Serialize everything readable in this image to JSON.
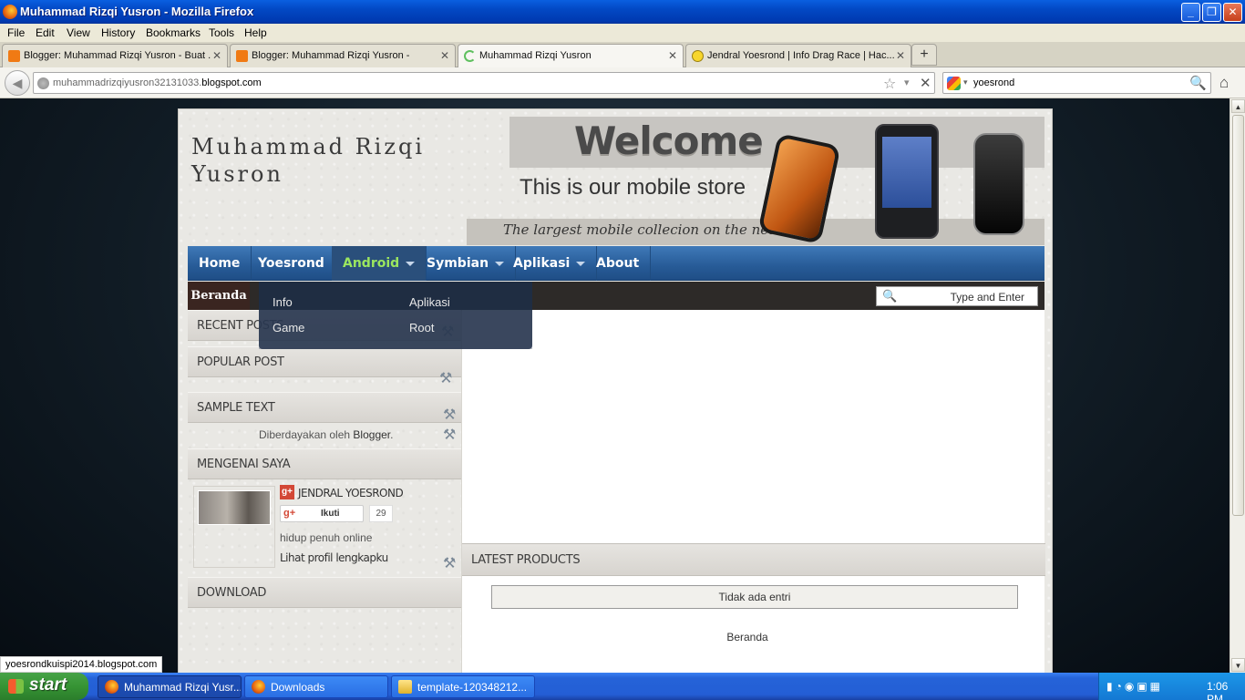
{
  "window": {
    "title": "Muhammad Rizqi Yusron - Mozilla Firefox",
    "controls": {
      "minimize": "_",
      "maximize": "❐",
      "close": "✕"
    }
  },
  "menu": [
    "File",
    "Edit",
    "View",
    "History",
    "Bookmarks",
    "Tools",
    "Help"
  ],
  "tabs": [
    {
      "label": "Blogger: Muhammad Rizqi Yusron - Buat ...",
      "close": "✕"
    },
    {
      "label": "Blogger: Muhammad Rizqi Yusron -",
      "close": "✕"
    },
    {
      "label": "Muhammad Rizqi Yusron",
      "close": "✕"
    },
    {
      "label": "Jendral Yoesrond | Info Drag Race | Hac...",
      "close": "✕"
    }
  ],
  "new_tab": "+",
  "nav": {
    "back": "◀",
    "url_prefix": "muhammadrizqiyusron32131033.",
    "url_domain": "blogspot.com",
    "star": "☆",
    "dropdown": "▾",
    "stop": "✕",
    "search_engine_dropdown": "▾",
    "search_value": "yoesrond",
    "search_glyph": "🔍",
    "home": "⌂"
  },
  "scrollbar": {
    "up": "▲",
    "down": "▼"
  },
  "site": {
    "title": "Muhammad Rizqi Yusron",
    "banner": {
      "welcome": "Welcome",
      "store": "This is our mobile store",
      "tagline": "The largest mobile collecion on the net"
    },
    "nav_items": [
      {
        "label": "Home"
      },
      {
        "label": "Yoesrond"
      },
      {
        "label": "Android"
      },
      {
        "label": "Symbian"
      },
      {
        "label": "Aplikasi"
      },
      {
        "label": "About"
      }
    ],
    "breadcrumb": "Beranda",
    "search": {
      "icon": "🔍",
      "placeholder": "Type and Enter"
    },
    "dropdown": [
      "Info",
      "Aplikasi",
      "Game",
      "Root"
    ],
    "widgets": {
      "recent_posts": "RECENT POSTS",
      "popular_post": "POPULAR POST",
      "sample_text": "SAMPLE TEXT",
      "powered_prefix": "Diberdayakan oleh",
      "powered_brand": "Blogger",
      "powered_suffix": ".",
      "about_me": "MENGENAI SAYA",
      "download": "DOWNLOAD",
      "tool_glyph": "⚒"
    },
    "profile": {
      "badge": "g+",
      "name": "JENDRAL YOESROND",
      "follow_icon": "g+",
      "follow_label": "Ikuti",
      "follow_count": "29",
      "description": "hidup penuh online",
      "link": "Lihat profil lengkapku"
    },
    "content": {
      "latest_products": "LATEST PRODUCTS",
      "no_entries": "Tidak ada entri",
      "home_link": "Beranda"
    }
  },
  "status_link": "yoesrondkuispi2014.blogspot.com",
  "taskbar": {
    "start": "start",
    "items": [
      "Muhammad Rizqi Yusr...",
      "Downloads",
      "template-120348212..."
    ],
    "tray_icons": "▮◔◉▣▦",
    "clock": "1:06 PM"
  }
}
